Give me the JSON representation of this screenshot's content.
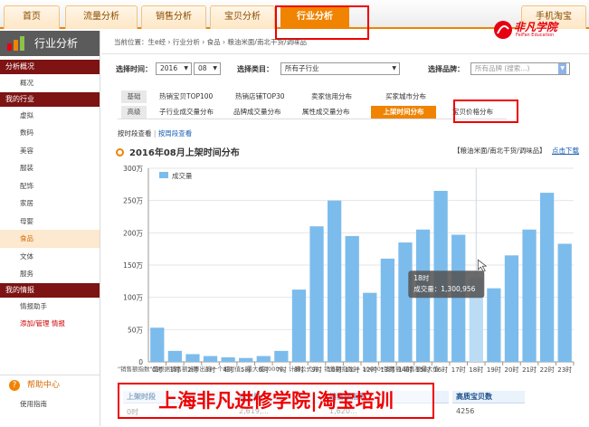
{
  "topnav": {
    "tabs": [
      "首页",
      "流量分析",
      "销售分析",
      "宝贝分析",
      "行业分析",
      "手机淘宝"
    ],
    "active": "行业分析"
  },
  "sidebar": {
    "title": "行业分析",
    "groups": [
      {
        "label": "分析概况",
        "items": [
          "概况"
        ]
      },
      {
        "label": "我的行业",
        "items": [
          "虚拟",
          "数码",
          "美容",
          "服装",
          "配饰",
          "家居",
          "母婴",
          "食品",
          "文体",
          "服务"
        ]
      },
      {
        "label": "我的情报",
        "items": [
          "情报助手",
          "添加/管理 情报"
        ]
      }
    ],
    "selected": "食品",
    "help_title": "帮助中心",
    "help_item": "使用指南"
  },
  "breadcrumb": "当前位置：生e经 › 行业分析 › 食品 › 粮油米面/南北干货/调味品",
  "filters": {
    "time_label": "选择时间：",
    "year": "2016",
    "month": "08",
    "category_label": "选择类目：",
    "category": "所有子行业",
    "brand_label": "选择品牌：",
    "brand_placeholder": "所有品牌 (搜索...)"
  },
  "subtabs": {
    "row1_badge": "基础",
    "row1": [
      "热销宝贝TOP100",
      "热销店铺TOP30",
      "卖家信用分布",
      "买家城市分布"
    ],
    "row2_badge": "高级",
    "row2": [
      "子行业成交量分布",
      "品牌成交量分布",
      "属性成交量分布",
      "上架时间分布",
      "宝贝价格分布"
    ],
    "active": "上架时间分布"
  },
  "view_toggle": {
    "by_time": "按时段查看",
    "by_week": "按周段查看"
  },
  "chart_header": {
    "title": "2016年08月上架时间分布",
    "category_tag": "【粮油米面/南北干货/调味品】",
    "download": "点击下载"
  },
  "tooltip": {
    "title": "18时",
    "label": "成交量：1,300,956"
  },
  "chart_data": {
    "type": "bar",
    "categories": [
      "0时",
      "1时",
      "2时",
      "3时",
      "4时",
      "5时",
      "6时",
      "7时",
      "8时",
      "9时",
      "10时",
      "11时",
      "12时",
      "13时",
      "14时",
      "15时",
      "16时",
      "17时",
      "18时",
      "19时",
      "20时",
      "21时",
      "22时",
      "23时"
    ],
    "series": [
      {
        "name": "成交量",
        "values": [
          530000,
          170000,
          120000,
          90000,
          70000,
          60000,
          90000,
          170000,
          1120000,
          2100000,
          2500000,
          1950000,
          1070000,
          1600000,
          1850000,
          2050000,
          2650000,
          1970000,
          1300956,
          1140000,
          1650000,
          2050000,
          2620000,
          1830000
        ]
      }
    ],
    "ylim": [
      0,
      3000000
    ],
    "yticks": [
      "0",
      "50万",
      "100万",
      "150万",
      "200万",
      "250万",
      "300万"
    ],
    "highlight_index": 18,
    "color": "#7cbcec",
    "highlight_color": "#b9dcf7",
    "grid": true,
    "legend": "top-left"
  },
  "footnote": "\"销售额指数\"是根据销售额计算出的一个相对值，最大值10000。计算公式为：销售额指数 = 10000*销售额/销售额最大值",
  "table": {
    "headers": [
      "上架时段",
      "成交量",
      "销售额指数",
      "高质宝贝数"
    ],
    "row": [
      "0时",
      "2,619,...",
      "1,620...",
      "4256"
    ]
  },
  "watermark": "上海非凡进修学院|淘宝培训",
  "brand": {
    "name": "非凡学院",
    "sub": "FeiFan Education"
  }
}
